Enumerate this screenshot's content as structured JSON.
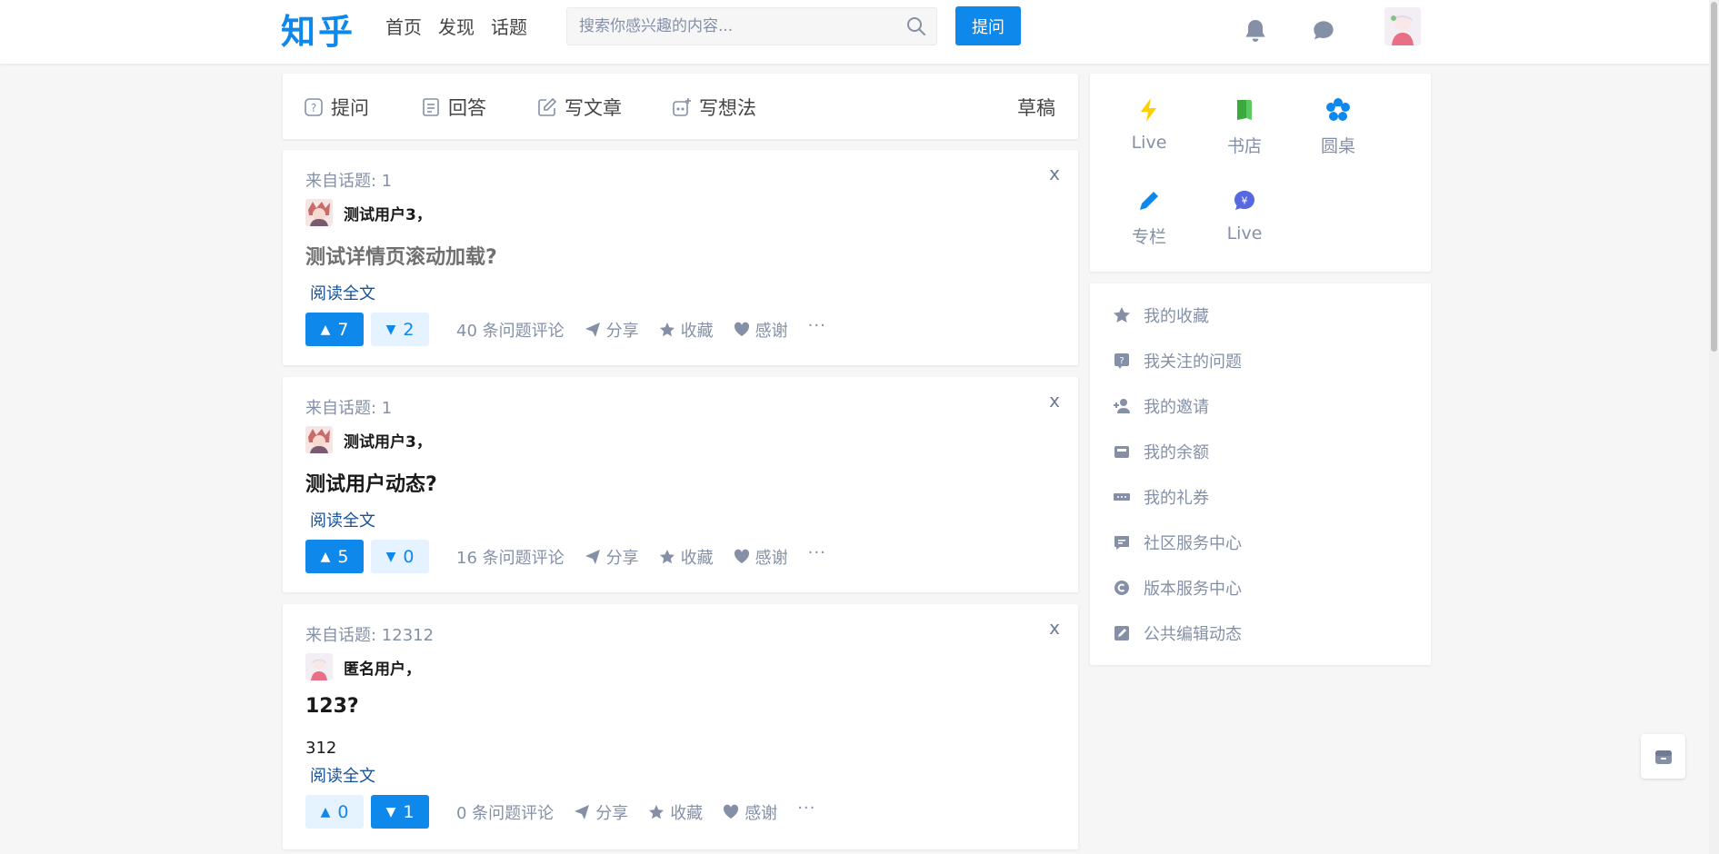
{
  "header": {
    "logo": "知乎",
    "nav": [
      "首页",
      "发现",
      "话题"
    ],
    "search_placeholder": "搜索你感兴趣的内容...",
    "ask_label": "提问"
  },
  "writer": {
    "ask": "提问",
    "answer": "回答",
    "article": "写文章",
    "idea": "写想法",
    "drafts": "草稿"
  },
  "feed": [
    {
      "topic": "来自话题: 1",
      "author": "测试用户3，",
      "title": "测试详情页滚动加载?",
      "excerpt": "",
      "read_more": "阅读全文",
      "upvotes": "7",
      "downvotes": "2",
      "comments": "40 条问题评论",
      "share": "分享",
      "collect": "收藏",
      "thanks": "感谢",
      "more": "···",
      "close": "x"
    },
    {
      "topic": "来自话题: 1",
      "author": "测试用户3，",
      "title": "测试用户动态?",
      "excerpt": "",
      "read_more": "阅读全文",
      "upvotes": "5",
      "downvotes": "0",
      "comments": "16 条问题评论",
      "share": "分享",
      "collect": "收藏",
      "thanks": "感谢",
      "more": "···",
      "close": "x"
    },
    {
      "topic": "来自话题: 12312",
      "author": "匿名用户，",
      "title": "123?",
      "excerpt": "312",
      "read_more": "阅读全文",
      "upvotes": "0",
      "downvotes": "1",
      "comments": "0 条问题评论",
      "share": "分享",
      "collect": "收藏",
      "thanks": "感谢",
      "more": "···",
      "close": "x"
    }
  ],
  "quick_links": [
    "Live",
    "书店",
    "圆桌",
    "专栏",
    "Live"
  ],
  "menu": [
    "我的收藏",
    "我关注的问题",
    "我的邀请",
    "我的余额",
    "我的礼券",
    "社区服务中心",
    "版本服务中心",
    "公共编辑动态"
  ],
  "colors": {
    "brand": "#0f88eb",
    "muted": "#8590a6",
    "link": "#175199",
    "background": "#f6f6f6"
  }
}
